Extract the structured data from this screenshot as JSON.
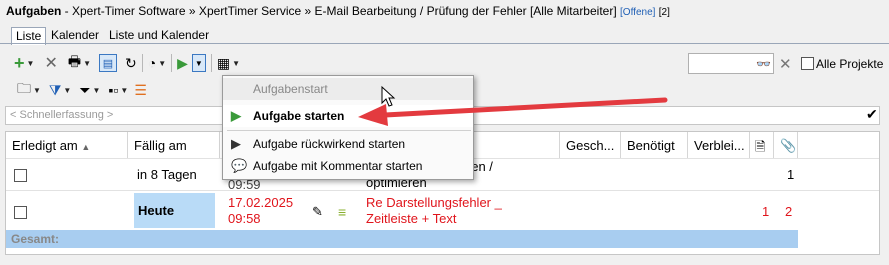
{
  "window": {
    "title_bold": "Aufgaben",
    "title_rest": " - Xpert-Timer Software » XpertTimer Service » E-Mail Bearbeitung / Prüfung der Fehler [Alle Mitarbeiter]",
    "badge": "[Offene]",
    "count": "[2]"
  },
  "tabs": [
    {
      "label": "Liste",
      "active": true
    },
    {
      "label": "Kalender",
      "active": false
    },
    {
      "label": "Liste und Kalender",
      "active": false
    }
  ],
  "toolbar": {
    "alle_projekte_label": "Alle Projekte",
    "search_value": ""
  },
  "quick_entry": {
    "placeholder": "< Schnellerfassung >"
  },
  "grid": {
    "columns": [
      "Erledigt am",
      "Fällig am",
      "Gesch...",
      "Benötigt",
      "Verblei..."
    ],
    "rows": [
      {
        "faellig": "in 8 Tagen",
        "time_partial": "09:59",
        "title_partial_1": "hen /",
        "title_partial_2": "optimieren",
        "attachments": "1"
      },
      {
        "faellig": "Heute",
        "date": "17.02.2025",
        "time": "09:58",
        "title_1": "Re Darstellungsfehler _",
        "title_2": "Zeitleiste + Text",
        "notes": "1",
        "attachments": "2"
      }
    ],
    "total_label": "Gesamt:"
  },
  "context_menu": {
    "header": "Aufgabenstart",
    "items": [
      {
        "label": "Aufgabe starten"
      },
      {
        "label": "Aufgabe rückwirkend starten"
      },
      {
        "label": "Aufgabe mit Kommentar starten"
      }
    ]
  },
  "colors": {
    "accent_red": "#e0151c",
    "selection_blue": "#a8cdf0",
    "play_green": "#3a9a3a"
  }
}
